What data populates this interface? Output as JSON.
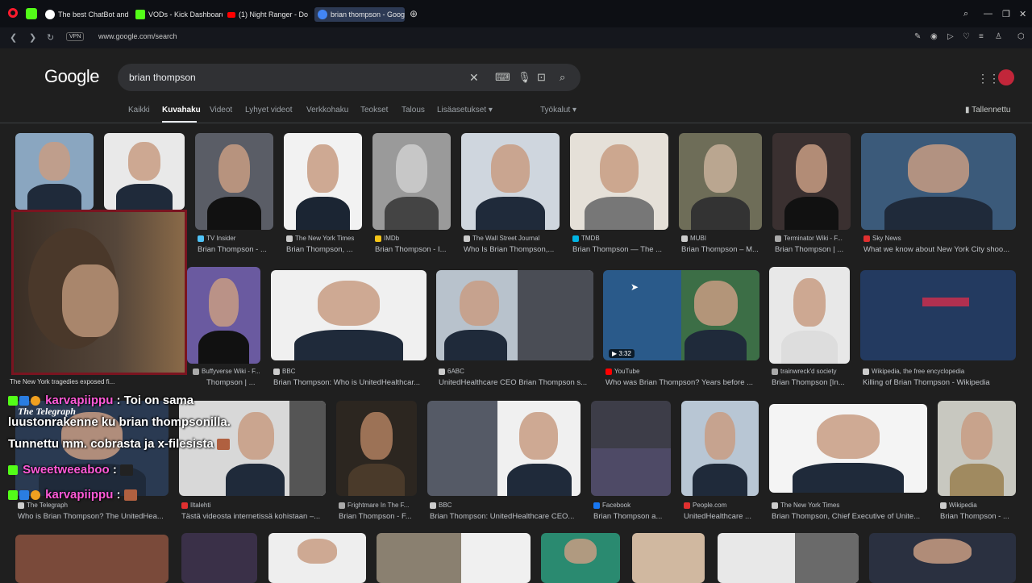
{
  "browser": {
    "tabs": [
      {
        "label": "The best ChatBot and Wi",
        "color": "#ffffff"
      },
      {
        "label": "VODs - Kick Dashboard",
        "color": "#53fc18"
      },
      {
        "label": "(1) Night Ranger - Do",
        "color": "#ff0000"
      },
      {
        "label": "brian thompson - Google",
        "color": "#4285f4"
      }
    ],
    "vpn": "VPN",
    "url": "www.google.com/search"
  },
  "google": {
    "logo": "Google",
    "query": "brian thompson",
    "tabs": [
      "Kaikki",
      "Kuvahaku",
      "Videot",
      "Lyhyet videot",
      "Verkkohaku",
      "Teokset",
      "Talous",
      "Lisäasetukset ▾",
      "Työkalut ▾"
    ],
    "saved": "Tallennettu"
  },
  "results": [
    {
      "source": "",
      "title": "",
      "src_color": "#888"
    },
    {
      "source": "",
      "title": "",
      "src_color": "#888"
    },
    {
      "source": "TV Insider",
      "title": "Brian Thompson - ...",
      "src_color": "#4fc3f7"
    },
    {
      "source": "The New York Times",
      "title": "Brian Thompson, ...",
      "src_color": "#cccccc"
    },
    {
      "source": "IMDb",
      "title": "Brian Thompson - I...",
      "src_color": "#f5c518"
    },
    {
      "source": "The Wall Street Journal",
      "title": "Who Is Brian Thompson,...",
      "src_color": "#cccccc"
    },
    {
      "source": "TMDB",
      "title": "Brian Thompson — The ...",
      "src_color": "#01b4e4"
    },
    {
      "source": "MUBI",
      "title": "Brian Thompson – M...",
      "src_color": "#cccccc"
    },
    {
      "source": "Terminator Wiki - F...",
      "title": "Brian Thompson | ...",
      "src_color": "#aaaaaa"
    },
    {
      "source": "Sky News",
      "title": "What we know about New York City shoo...",
      "src_color": "#e03030"
    },
    {
      "source": "Buffyverse Wiki - F...",
      "title": "Thompson | ...",
      "src_color": "#aaaaaa"
    },
    {
      "source": "BBC",
      "title": "Brian Thompson: Who is UnitedHealthcar...",
      "src_color": "#cccccc"
    },
    {
      "source": "6ABC",
      "title": "UnitedHealthcare CEO Brian Thompson s...",
      "src_color": "#cccccc"
    },
    {
      "source": "YouTube",
      "title": "Who was Brian Thompson? Years before ...",
      "src_color": "#ff0000"
    },
    {
      "source": "trainwreck'd society",
      "title": "Brian Thompson [In...",
      "src_color": "#aaaaaa"
    },
    {
      "source": "Wikipedia, the free encyclopedia",
      "title": "Killing of Brian Thompson - Wikipedia",
      "src_color": "#cccccc"
    },
    {
      "source": "The Telegraph",
      "title": "Who is Brian Thompson? The UnitedHea...",
      "src_color": "#cccccc"
    },
    {
      "source": "Iltalehti",
      "title": "Tästä videosta internetissä kohistaan –...",
      "src_color": "#e03030"
    },
    {
      "source": "Frightmare In The F...",
      "title": "Brian Thompson - F...",
      "src_color": "#aaaaaa"
    },
    {
      "source": "BBC",
      "title": "Brian Thompson: UnitedHealthcare CEO...",
      "src_color": "#cccccc"
    },
    {
      "source": "Facebook",
      "title": "Brian Thompson a...",
      "src_color": "#1877f2"
    },
    {
      "source": "People.com",
      "title": "UnitedHealthcare ...",
      "src_color": "#e03030"
    },
    {
      "source": "The New York Times",
      "title": "Brian Thompson, Chief Executive of Unite...",
      "src_color": "#cccccc"
    },
    {
      "source": "Wikipedia",
      "title": "Brian Thompson - ...",
      "src_color": "#cccccc"
    }
  ],
  "video_duration": "▶ 3:32",
  "overlay": {
    "ticker": "The New York tragedies exposed fi...",
    "telegraph": "The Telegraph",
    "chat": [
      {
        "user": "karvapiippu",
        "text": ": Toi on sama"
      },
      {
        "text": "luustonrakenne ku brian thompsonilla."
      },
      {
        "text": "Tunnettu mm. cobrasta ja x-filesista"
      },
      {
        "user": "Sweetweeaboo",
        "text": ":"
      },
      {
        "user": "karvapiippu",
        "text": ":"
      }
    ]
  }
}
